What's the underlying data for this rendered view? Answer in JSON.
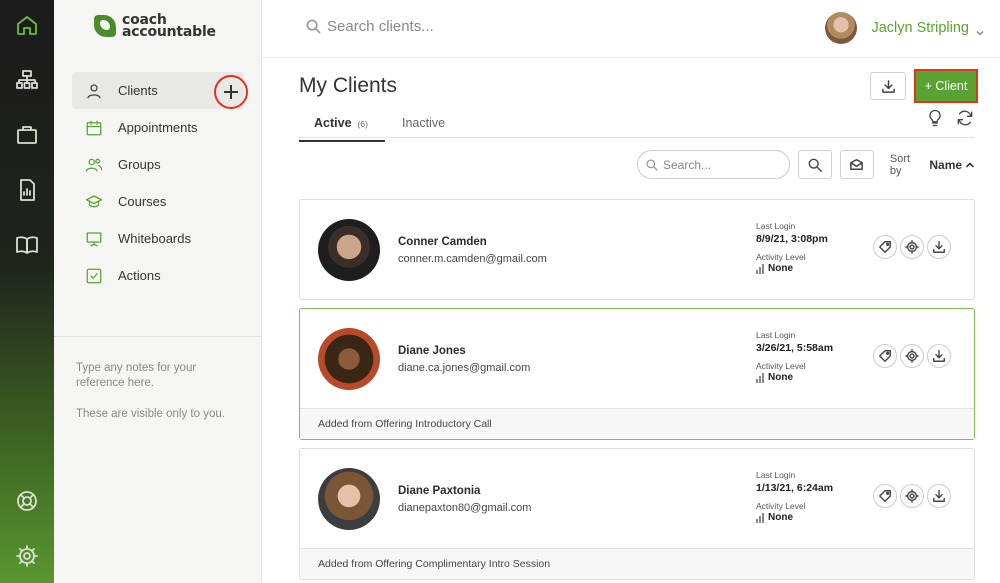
{
  "app": {
    "logo_line1": "coach",
    "logo_line2": "accountable"
  },
  "rail": {
    "items": [
      {
        "icon": "home-icon"
      },
      {
        "icon": "org-chart-icon"
      },
      {
        "icon": "briefcase-icon"
      },
      {
        "icon": "report-icon"
      },
      {
        "icon": "book-icon"
      },
      {
        "icon": "lifebuoy-icon"
      },
      {
        "icon": "gear-icon"
      }
    ]
  },
  "sidebar": {
    "items": [
      {
        "label": "Clients",
        "icon": "person-icon"
      },
      {
        "label": "Appointments",
        "icon": "calendar-icon"
      },
      {
        "label": "Groups",
        "icon": "group-icon"
      },
      {
        "label": "Courses",
        "icon": "graduation-cap-icon"
      },
      {
        "label": "Whiteboards",
        "icon": "whiteboard-icon"
      },
      {
        "label": "Actions",
        "icon": "checkbox-icon"
      }
    ],
    "notes_line1": "Type any notes for your reference here.",
    "notes_line2": "These are visible only to you."
  },
  "topbar": {
    "search_placeholder": "Search clients...",
    "user_name": "Jaclyn Stripling"
  },
  "main": {
    "title": "My Clients",
    "add_client_label": "+ Client",
    "tabs": {
      "active_label": "Active",
      "active_count": "(6)",
      "inactive_label": "Inactive"
    },
    "filter": {
      "search_placeholder": "Search...",
      "sort_label": "Sort by",
      "sort_value": "Name"
    }
  },
  "clients": [
    {
      "name": "Conner Camden",
      "email": "conner.m.camden@gmail.com",
      "last_login_label": "Last Login",
      "last_login": "8/9/21, 3:08pm",
      "activity_label": "Activity Level",
      "activity": "None",
      "footer": ""
    },
    {
      "name": "Diane Jones",
      "email": "diane.ca.jones@gmail.com",
      "last_login_label": "Last Login",
      "last_login": "3/26/21, 5:58am",
      "activity_label": "Activity Level",
      "activity": "None",
      "footer": "Added from Offering Introductory Call"
    },
    {
      "name": "Diane Paxtonia",
      "email": "dianepaxton80@gmail.com",
      "last_login_label": "Last Login",
      "last_login": "1/13/21, 6:24am",
      "activity_label": "Activity Level",
      "activity": "None",
      "footer": "Added from Offering Complimentary Intro Session"
    }
  ],
  "colors": {
    "brand_green": "#5aa332",
    "highlight_red": "#e0341f"
  }
}
